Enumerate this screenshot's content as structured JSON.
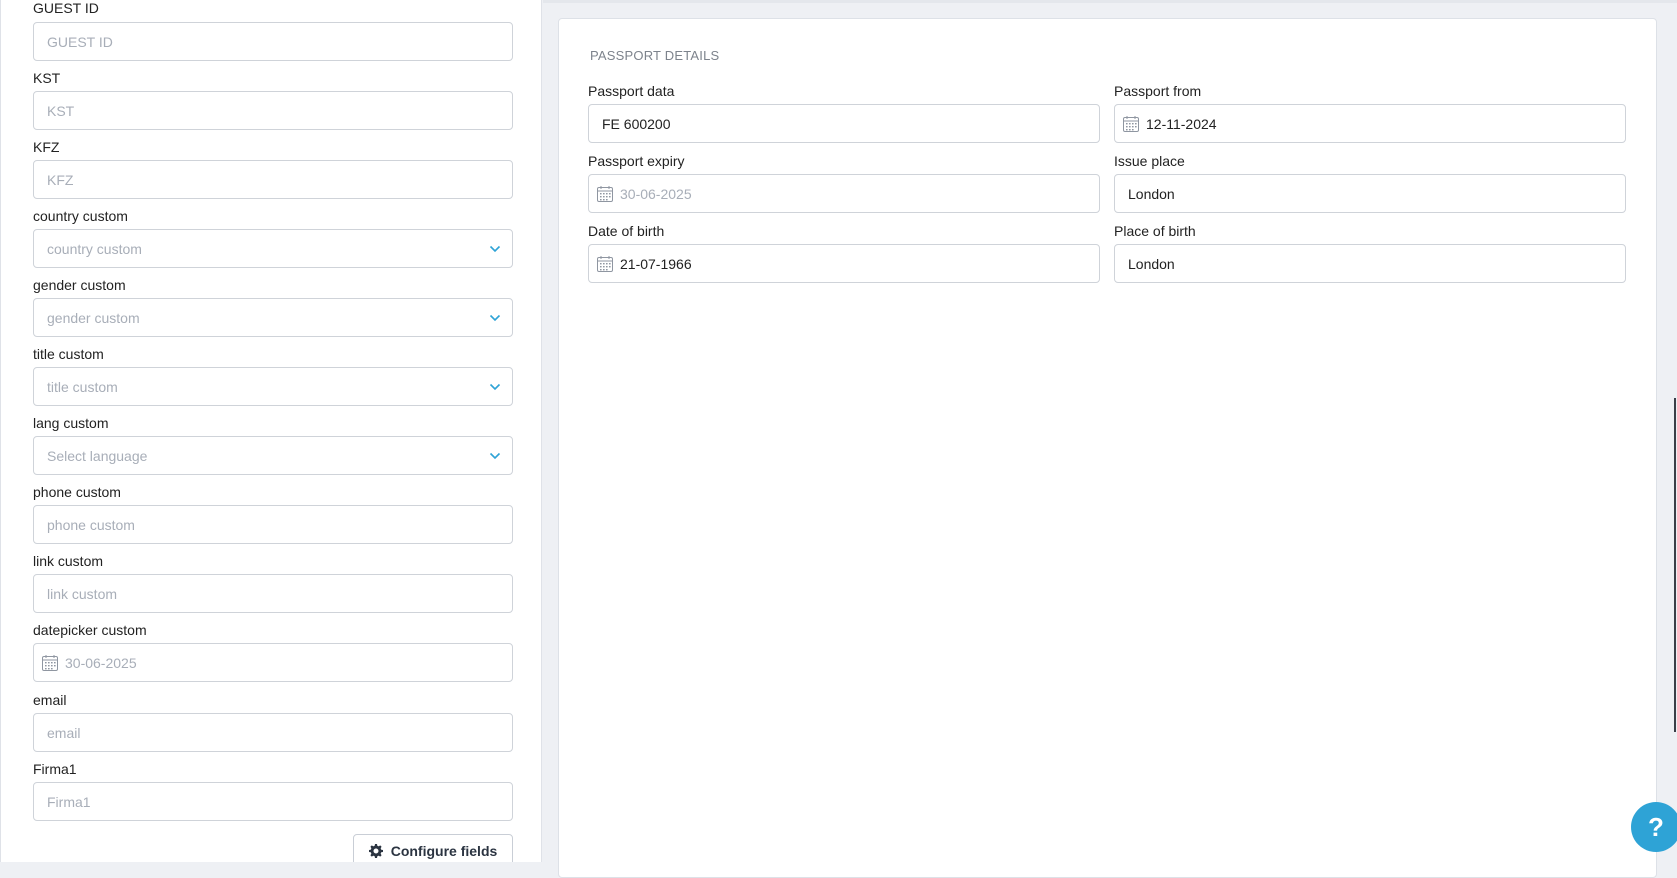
{
  "left_form": {
    "fields": [
      {
        "label": "GUEST ID",
        "placeholder": "GUEST ID",
        "type": "text"
      },
      {
        "label": "KST",
        "placeholder": "KST",
        "type": "text"
      },
      {
        "label": "KFZ",
        "placeholder": "KFZ",
        "type": "text"
      },
      {
        "label": "country custom",
        "placeholder": "country custom",
        "type": "select"
      },
      {
        "label": "gender custom",
        "placeholder": "gender custom",
        "type": "select"
      },
      {
        "label": "title custom",
        "placeholder": "title custom",
        "type": "select"
      },
      {
        "label": "lang custom",
        "placeholder": "Select language",
        "type": "select"
      },
      {
        "label": "phone custom",
        "placeholder": "phone custom",
        "type": "text"
      },
      {
        "label": "link custom",
        "placeholder": "link custom",
        "type": "text"
      },
      {
        "label": "datepicker custom",
        "placeholder": "30-06-2025",
        "type": "date"
      },
      {
        "label": "email",
        "placeholder": "email",
        "type": "text"
      },
      {
        "label": "Firma1",
        "placeholder": "Firma1",
        "type": "text"
      }
    ],
    "configure_button": "Configure fields"
  },
  "passport": {
    "title": "PASSPORT DETAILS",
    "passport_data": {
      "label": "Passport data",
      "value": "FE 600200"
    },
    "passport_from": {
      "label": "Passport from",
      "value": "12-11-2024"
    },
    "passport_expiry": {
      "label": "Passport expiry",
      "placeholder": "30-06-2025"
    },
    "issue_place": {
      "label": "Issue place",
      "value": "London"
    },
    "date_of_birth": {
      "label": "Date of birth",
      "value": "21-07-1966"
    },
    "place_of_birth": {
      "label": "Place of birth",
      "value": "London"
    }
  },
  "help": {
    "label": "?"
  },
  "colors": {
    "accent": "#2ea3d6",
    "border": "#cfd3d9",
    "placeholder": "#a8aeb8"
  }
}
